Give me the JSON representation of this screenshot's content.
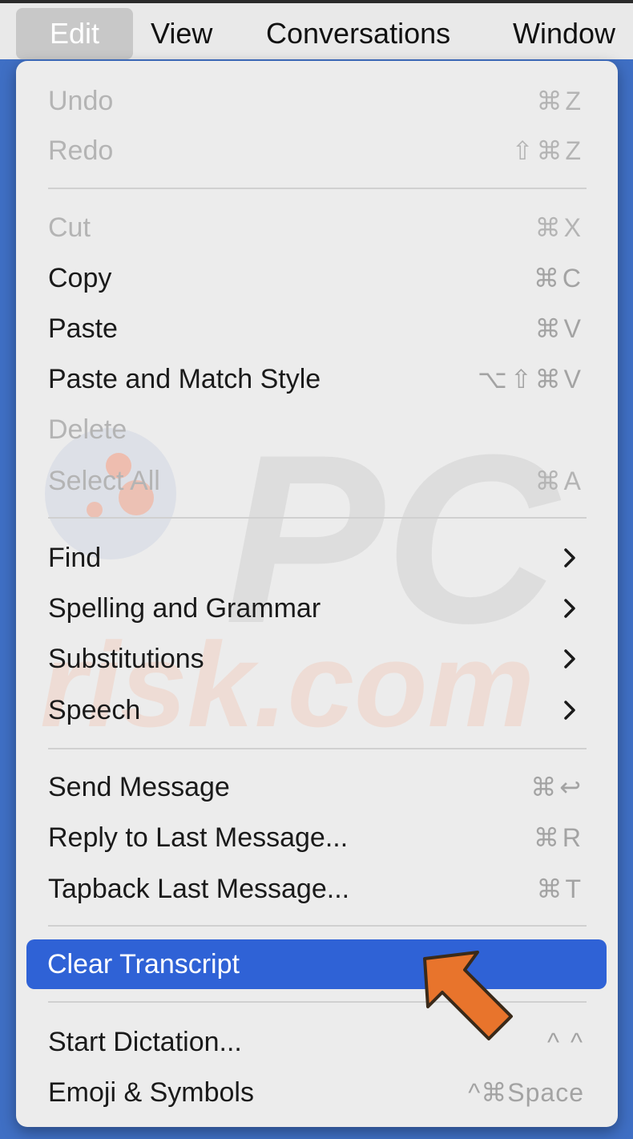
{
  "menubar": {
    "items": [
      {
        "label": "Edit",
        "active": true
      },
      {
        "label": "View"
      },
      {
        "label": "Conversations"
      },
      {
        "label": "Window"
      }
    ]
  },
  "menu": {
    "items": [
      {
        "label": "Undo",
        "shortcut": "⌘Z",
        "disabled": true
      },
      {
        "label": "Redo",
        "shortcut": "⇧⌘Z",
        "disabled": true
      },
      {
        "label": "Cut",
        "shortcut": "⌘X",
        "disabled": true
      },
      {
        "label": "Copy",
        "shortcut": "⌘C"
      },
      {
        "label": "Paste",
        "shortcut": "⌘V"
      },
      {
        "label": "Paste and Match Style",
        "shortcut": "⌥⇧⌘V"
      },
      {
        "label": "Delete",
        "shortcut": "",
        "disabled": true
      },
      {
        "label": "Select All",
        "shortcut": "⌘A",
        "disabled": true
      },
      {
        "label": "Find",
        "submenu": true
      },
      {
        "label": "Spelling and Grammar",
        "submenu": true
      },
      {
        "label": "Substitutions",
        "submenu": true
      },
      {
        "label": "Speech",
        "submenu": true
      },
      {
        "label": "Send Message",
        "shortcut": "⌘↩"
      },
      {
        "label": "Reply to Last Message...",
        "shortcut": "⌘R"
      },
      {
        "label": "Tapback Last Message...",
        "shortcut": "⌘T"
      },
      {
        "label": "Clear Transcript",
        "highlighted": true
      },
      {
        "label": "Start Dictation...",
        "shortcut": "^^"
      },
      {
        "label": "Emoji & Symbols",
        "shortcut": "^⌘Space"
      }
    ]
  },
  "colors": {
    "highlight": "#2f62d6",
    "arrow": "#e8742c",
    "background": "#3f6fc4"
  },
  "watermark": {
    "text_top": "PC",
    "text_bottom": "risk.com"
  }
}
